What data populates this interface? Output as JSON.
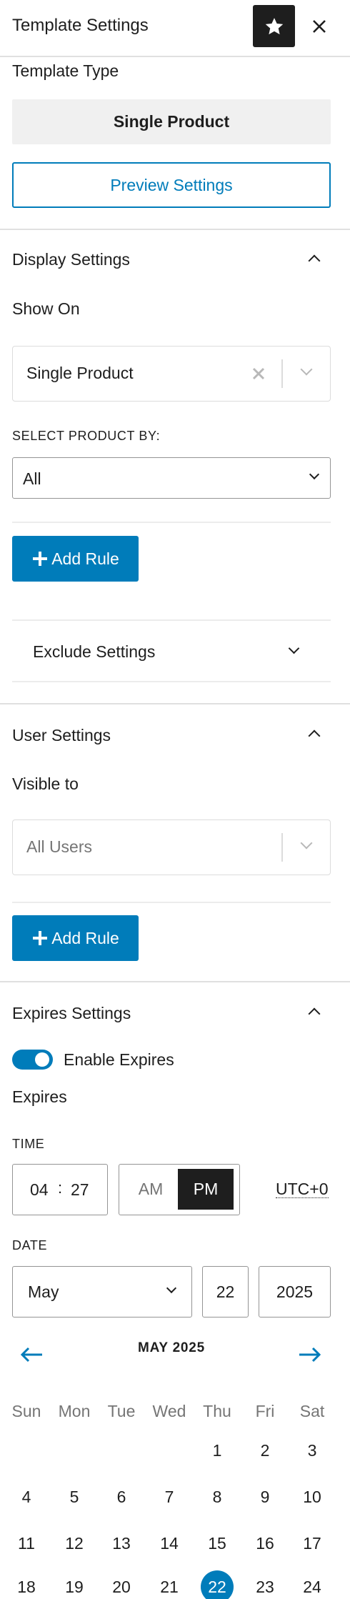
{
  "header": {
    "title": "Template Settings"
  },
  "template_type": {
    "label": "Template Type",
    "value": "Single Product",
    "preview_button": "Preview Settings"
  },
  "display_settings": {
    "title": "Display Settings",
    "show_on_label": "Show On",
    "show_on_value": "Single Product",
    "select_by_label": "SELECT PRODUCT BY:",
    "select_by_value": "All",
    "add_rule": "Add Rule",
    "exclude_title": "Exclude Settings"
  },
  "user_settings": {
    "title": "User Settings",
    "visible_label": "Visible to",
    "visible_placeholder": "All Users",
    "add_rule": "Add Rule"
  },
  "expires_settings": {
    "title": "Expires Settings",
    "toggle_label": "Enable Expires",
    "toggle_on": true,
    "expires_label": "Expires",
    "time_label": "TIME",
    "hour": "04",
    "minute": "27",
    "am": "AM",
    "pm": "PM",
    "timezone": "UTC+0",
    "date_label": "DATE",
    "month": "May",
    "day": "22",
    "year": "2025"
  },
  "calendar": {
    "title": "MAY 2025",
    "weekdays": [
      "Sun",
      "Mon",
      "Tue",
      "Wed",
      "Thu",
      "Fri",
      "Sat"
    ],
    "weeks": [
      [
        "",
        "",
        "",
        "",
        "1",
        "2",
        "3"
      ],
      [
        "4",
        "5",
        "6",
        "7",
        "8",
        "9",
        "10"
      ],
      [
        "11",
        "12",
        "13",
        "14",
        "15",
        "16",
        "17"
      ],
      [
        "18",
        "19",
        "20",
        "21",
        "22",
        "23",
        "24"
      ]
    ],
    "selected": "22"
  },
  "colors": {
    "accent": "#007cba",
    "dark": "#1e1e1e"
  }
}
